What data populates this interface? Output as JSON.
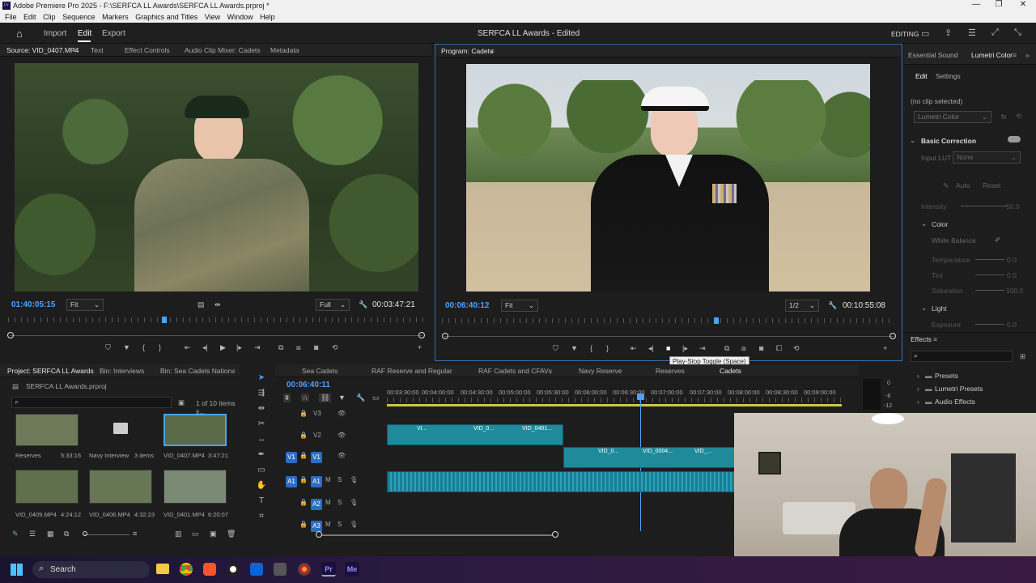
{
  "window": {
    "title": "Adobe Premiere Pro 2025 - F:\\SERFCA LL Awards\\SERFCA LL Awards.prproj *"
  },
  "menu": [
    "File",
    "Edit",
    "Clip",
    "Sequence",
    "Markers",
    "Graphics and Titles",
    "View",
    "Window",
    "Help"
  ],
  "header": {
    "nav": [
      "Import",
      "Edit",
      "Export"
    ],
    "project_title": "SERFCA LL Awards - Edited",
    "workspace": "EDITING"
  },
  "source_panel": {
    "tabs": [
      "Source: VID_0407.MP4",
      "Text",
      "Effect Controls",
      "Audio Clip Mixer: Cadets",
      "Metadata"
    ],
    "timecode": "01:40:05:15",
    "fit": "Fit",
    "resolution": "Full",
    "duration": "00:03:47:21"
  },
  "program_panel": {
    "tab": "Program: Cadets",
    "timecode": "00:06:40:12",
    "fit": "Fit",
    "resolution": "1/2",
    "duration": "00:10:55:08",
    "tooltip": "Play-Stop Toggle (Space)"
  },
  "lumetri": {
    "tabs": [
      "Essential Sound",
      "Lumetri Color"
    ],
    "subtabs": [
      "Edit",
      "Settings"
    ],
    "no_clip": "(no clip selected)",
    "effect_name": "Lumetri Color",
    "basic_correction": "Basic Correction",
    "input_lut_label": "Input LUT",
    "input_lut_value": "None",
    "auto": "Auto",
    "reset": "Reset",
    "intensity_label": "Intensity",
    "intensity_value": "50.0",
    "color_section": "Color",
    "white_balance": "White Balance",
    "temperature_label": "Temperature",
    "temperature_value": "0.0",
    "tint_label": "Tint",
    "tint_value": "0.0",
    "saturation_label": "Saturation",
    "saturation_value": "100.0",
    "light_section": "Light",
    "exposure_label": "Exposure",
    "exposure_value": "0.0"
  },
  "effects": {
    "title": "Effects",
    "items": [
      "Presets",
      "Lumetri Presets",
      "Audio Effects"
    ]
  },
  "project": {
    "tabs": [
      "Project: SERFCA LL Awards",
      "Bin: Interviews",
      "Bin: Sea Cadets National Ba"
    ],
    "file": "SERFCA LL Awards.prproj",
    "count": "1 of 10 items s...",
    "items": [
      {
        "name": "Reserves",
        "dur": "5:33:16"
      },
      {
        "name": "Navy Interview",
        "dur": "3 items"
      },
      {
        "name": "VID_0407.MP4",
        "dur": "3:47:21"
      },
      {
        "name": "VID_0409.MP4",
        "dur": "4:24:12"
      },
      {
        "name": "VID_0406.MP4",
        "dur": "4:32:23"
      },
      {
        "name": "VID_0401.MP4",
        "dur": "6:20:07"
      }
    ]
  },
  "timeline": {
    "tabs": [
      "Sea Cadets",
      "RAF Reserve and Regular",
      "RAF Cadets and CFAVs",
      "Navy Reserve",
      "Reserves",
      "Cadets"
    ],
    "timecode": "00:06:40:11",
    "ruler": [
      "00:03:30:00",
      "00:04:00:00",
      "00:04:30:00",
      "00:05:00:00",
      "00:05:30:00",
      "00:06:00:00",
      "00:06:30:00",
      "00:07:00:00",
      "00:07:30:00",
      "00:08:00:00",
      "00:08:30:00",
      "00:09:00:00"
    ],
    "tracks": [
      "V3",
      "V2",
      "V1",
      "A1",
      "A2",
      "A3"
    ],
    "clip_labels": [
      "VI...",
      "VID_0...",
      "VID_0401...",
      "VID_0...",
      "VID_0004...",
      "VID_..."
    ],
    "meter_labels": [
      "0",
      "-6",
      "-12"
    ]
  },
  "taskbar": {
    "search": "Search"
  }
}
